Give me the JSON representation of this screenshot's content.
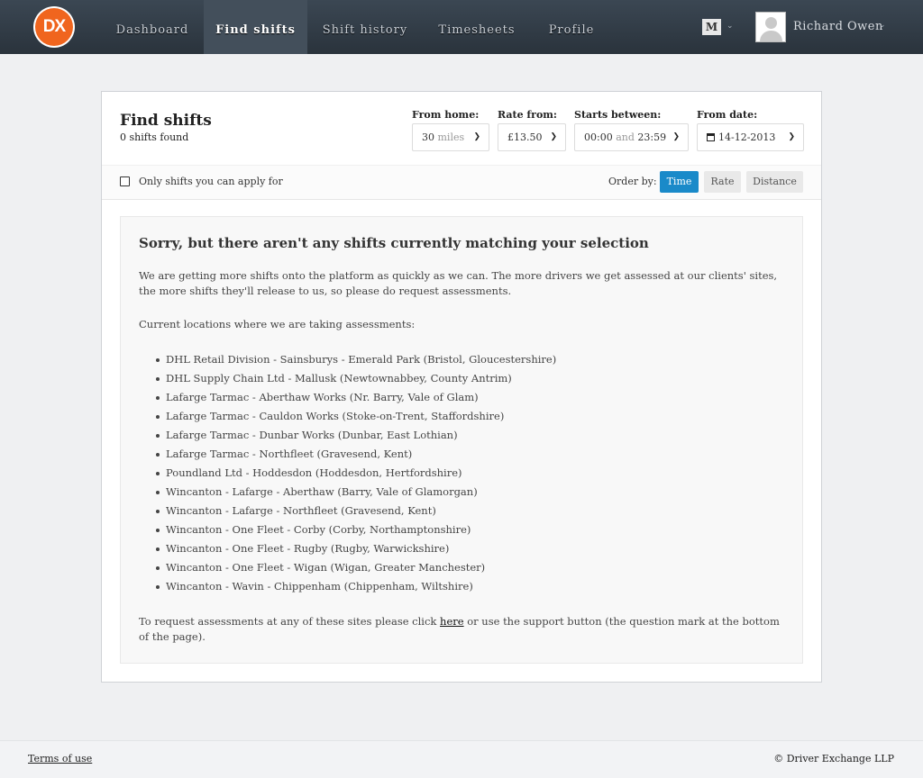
{
  "logo": {
    "text": "DX"
  },
  "nav": {
    "items": [
      {
        "label": "Dashboard"
      },
      {
        "label": "Find shifts"
      },
      {
        "label": "Shift history"
      },
      {
        "label": "Timesheets"
      },
      {
        "label": "Profile"
      }
    ],
    "active_index": 1,
    "lang_badge": "M",
    "user_name": "Richard Owen"
  },
  "header": {
    "title": "Find shifts",
    "count": "0 shifts found"
  },
  "filters": {
    "from_home": {
      "label": "From home:",
      "value": "30",
      "unit": "miles"
    },
    "rate_from": {
      "label": "Rate from:",
      "value": "£13.50"
    },
    "starts_between": {
      "label": "Starts between:",
      "start": "00:00",
      "connector": "and",
      "end": "23:59"
    },
    "from_date": {
      "label": "From date:",
      "value": "14-12-2013"
    }
  },
  "subbar": {
    "only_apply_label": "Only shifts you can apply for",
    "only_apply_checked": false,
    "order_label": "Order by:",
    "order_options": [
      "Time",
      "Rate",
      "Distance"
    ],
    "order_selected": "Time"
  },
  "message": {
    "title": "Sorry, but there aren't any shifts currently matching your selection",
    "p1": "We are getting more shifts onto the platform as quickly as we can. The more drivers we get assessed at our clients' sites, the more shifts they'll release to us, so please do request assessments.",
    "p2": "Current locations where we are taking assessments:",
    "locations": [
      "DHL Retail Division - Sainsburys - Emerald Park (Bristol, Gloucestershire)",
      "DHL Supply Chain Ltd - Mallusk (Newtownabbey, County Antrim)",
      "Lafarge Tarmac - Aberthaw Works (Nr. Barry, Vale of Glam)",
      "Lafarge Tarmac - Cauldon Works (Stoke-on-Trent, Staffordshire)",
      "Lafarge Tarmac - Dunbar Works (Dunbar, East Lothian)",
      "Lafarge Tarmac - Northfleet (Gravesend, Kent)",
      "Poundland Ltd - Hoddesdon (Hoddesdon, Hertfordshire)",
      "Wincanton - Lafarge - Aberthaw (Barry, Vale of Glamorgan)",
      "Wincanton - Lafarge - Northfleet (Gravesend, Kent)",
      "Wincanton - One Fleet - Corby (Corby, Northamptonshire)",
      "Wincanton - One Fleet - Rugby (Rugby, Warwickshire)",
      "Wincanton - One Fleet - Wigan (Wigan, Greater Manchester)",
      "Wincanton - Wavin - Chippenham (Chippenham, Wiltshire)"
    ],
    "p3_before": "To request assessments at any of these sites please click ",
    "p3_link": "here",
    "p3_after": " or use the support button (the question mark at the bottom of the page)."
  },
  "footer": {
    "terms": "Terms of use",
    "copyright": "© Driver Exchange LLP"
  },
  "colors": {
    "nav_bg": "#2f3a44",
    "logo_orange": "#f0651e",
    "active_order": "#1a8ac9",
    "page_bg": "#eff0f2"
  }
}
